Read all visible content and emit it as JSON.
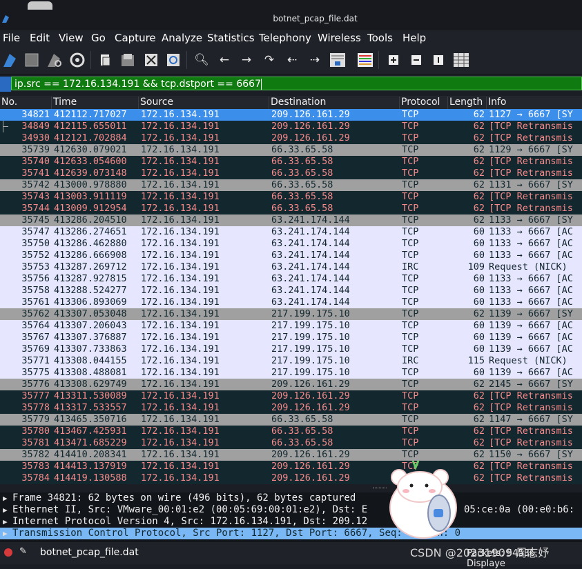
{
  "window": {
    "title": "botnet_pcap_file.dat"
  },
  "menu": [
    "File",
    "Edit",
    "View",
    "Go",
    "Capture",
    "Analyze",
    "Statistics",
    "Telephony",
    "Wireless",
    "Tools",
    "Help"
  ],
  "filter": {
    "value": "ip.src == 172.16.134.191 && tcp.dstport == 6667",
    "bg": "#0f7a0f"
  },
  "columns": {
    "no": "No.",
    "time": "Time",
    "source": "Source",
    "destination": "Destination",
    "protocol": "Protocol",
    "length": "Length",
    "info": "Info"
  },
  "packets": [
    {
      "no": "34821",
      "time": "412112.717027",
      "src": "172.16.134.191",
      "dst": "209.126.161.29",
      "proto": "TCP",
      "len": "62",
      "info": "1127 → 6667 [SY",
      "style": "sel"
    },
    {
      "no": "34849",
      "time": "412115.655011",
      "src": "172.16.134.191",
      "dst": "209.126.161.29",
      "proto": "TCP",
      "len": "62",
      "info": "[TCP Retransmis",
      "style": "red"
    },
    {
      "no": "34930",
      "time": "412121.702884",
      "src": "172.16.134.191",
      "dst": "209.126.161.29",
      "proto": "TCP",
      "len": "62",
      "info": "[TCP Retransmis",
      "style": "red"
    },
    {
      "no": "35739",
      "time": "412630.079021",
      "src": "172.16.134.191",
      "dst": "66.33.65.58",
      "proto": "TCP",
      "len": "62",
      "info": "1129 → 6667 [SY",
      "style": "gray"
    },
    {
      "no": "35740",
      "time": "412633.054600",
      "src": "172.16.134.191",
      "dst": "66.33.65.58",
      "proto": "TCP",
      "len": "62",
      "info": "[TCP Retransmis",
      "style": "red"
    },
    {
      "no": "35741",
      "time": "412639.073148",
      "src": "172.16.134.191",
      "dst": "66.33.65.58",
      "proto": "TCP",
      "len": "62",
      "info": "[TCP Retransmis",
      "style": "red"
    },
    {
      "no": "35742",
      "time": "413000.978880",
      "src": "172.16.134.191",
      "dst": "66.33.65.58",
      "proto": "TCP",
      "len": "62",
      "info": "1131 → 6667 [SY",
      "style": "gray"
    },
    {
      "no": "35743",
      "time": "413003.911119",
      "src": "172.16.134.191",
      "dst": "66.33.65.58",
      "proto": "TCP",
      "len": "62",
      "info": "[TCP Retransmis",
      "style": "red"
    },
    {
      "no": "35744",
      "time": "413009.912954",
      "src": "172.16.134.191",
      "dst": "66.33.65.58",
      "proto": "TCP",
      "len": "62",
      "info": "[TCP Retransmis",
      "style": "red"
    },
    {
      "no": "35745",
      "time": "413286.204510",
      "src": "172.16.134.191",
      "dst": "63.241.174.144",
      "proto": "TCP",
      "len": "62",
      "info": "1133 → 6667 [SY",
      "style": "gray"
    },
    {
      "no": "35747",
      "time": "413286.274651",
      "src": "172.16.134.191",
      "dst": "63.241.174.144",
      "proto": "TCP",
      "len": "60",
      "info": "1133 → 6667 [AC",
      "style": "blue"
    },
    {
      "no": "35750",
      "time": "413286.462880",
      "src": "172.16.134.191",
      "dst": "63.241.174.144",
      "proto": "TCP",
      "len": "60",
      "info": "1133 → 6667 [AC",
      "style": "blue"
    },
    {
      "no": "35752",
      "time": "413286.666908",
      "src": "172.16.134.191",
      "dst": "63.241.174.144",
      "proto": "TCP",
      "len": "60",
      "info": "1133 → 6667 [AC",
      "style": "blue"
    },
    {
      "no": "35753",
      "time": "413287.269712",
      "src": "172.16.134.191",
      "dst": "63.241.174.144",
      "proto": "IRC",
      "len": "109",
      "info": "Request (NICK)",
      "style": "blue"
    },
    {
      "no": "35756",
      "time": "413287.927815",
      "src": "172.16.134.191",
      "dst": "63.241.174.144",
      "proto": "TCP",
      "len": "60",
      "info": "1133 → 6667 [AC",
      "style": "blue"
    },
    {
      "no": "35758",
      "time": "413288.524277",
      "src": "172.16.134.191",
      "dst": "63.241.174.144",
      "proto": "TCP",
      "len": "60",
      "info": "1133 → 6667 [AC",
      "style": "blue"
    },
    {
      "no": "35761",
      "time": "413306.893069",
      "src": "172.16.134.191",
      "dst": "63.241.174.144",
      "proto": "TCP",
      "len": "60",
      "info": "1133 → 6667 [AC",
      "style": "blue"
    },
    {
      "no": "35762",
      "time": "413307.053048",
      "src": "172.16.134.191",
      "dst": "217.199.175.10",
      "proto": "TCP",
      "len": "62",
      "info": "1139 → 6667 [SY",
      "style": "gray"
    },
    {
      "no": "35764",
      "time": "413307.206043",
      "src": "172.16.134.191",
      "dst": "217.199.175.10",
      "proto": "TCP",
      "len": "60",
      "info": "1139 → 6667 [AC",
      "style": "blue"
    },
    {
      "no": "35767",
      "time": "413307.376887",
      "src": "172.16.134.191",
      "dst": "217.199.175.10",
      "proto": "TCP",
      "len": "60",
      "info": "1139 → 6667 [AC",
      "style": "blue"
    },
    {
      "no": "35769",
      "time": "413307.733863",
      "src": "172.16.134.191",
      "dst": "217.199.175.10",
      "proto": "TCP",
      "len": "60",
      "info": "1139 → 6667 [AC",
      "style": "blue"
    },
    {
      "no": "35771",
      "time": "413308.044155",
      "src": "172.16.134.191",
      "dst": "217.199.175.10",
      "proto": "IRC",
      "len": "115",
      "info": "Request (NICK)",
      "style": "blue"
    },
    {
      "no": "35775",
      "time": "413308.488081",
      "src": "172.16.134.191",
      "dst": "217.199.175.10",
      "proto": "TCP",
      "len": "60",
      "info": "1139 → 6667 [AC",
      "style": "blue"
    },
    {
      "no": "35776",
      "time": "413308.629749",
      "src": "172.16.134.191",
      "dst": "209.126.161.29",
      "proto": "TCP",
      "len": "62",
      "info": "2145 → 6667 [SY",
      "style": "gray"
    },
    {
      "no": "35777",
      "time": "413311.530089",
      "src": "172.16.134.191",
      "dst": "209.126.161.29",
      "proto": "TCP",
      "len": "62",
      "info": "[TCP Retransmis",
      "style": "red"
    },
    {
      "no": "35778",
      "time": "413317.533557",
      "src": "172.16.134.191",
      "dst": "209.126.161.29",
      "proto": "TCP",
      "len": "62",
      "info": "[TCP Retransmis",
      "style": "red"
    },
    {
      "no": "35779",
      "time": "413465.350716",
      "src": "172.16.134.191",
      "dst": "66.33.65.58",
      "proto": "TCP",
      "len": "62",
      "info": "1147 → 6667 [SY",
      "style": "gray"
    },
    {
      "no": "35780",
      "time": "413467.425931",
      "src": "172.16.134.191",
      "dst": "66.33.65.58",
      "proto": "TCP",
      "len": "62",
      "info": "[TCP Retransmis",
      "style": "red"
    },
    {
      "no": "35781",
      "time": "413471.685229",
      "src": "172.16.134.191",
      "dst": "66.33.65.58",
      "proto": "TCP",
      "len": "62",
      "info": "[TCP Retransmis",
      "style": "red"
    },
    {
      "no": "35782",
      "time": "414410.208341",
      "src": "172.16.134.191",
      "dst": "209.126.161.29",
      "proto": "TCP",
      "len": "62",
      "info": "1150 → 6667 [SY",
      "style": "gray"
    },
    {
      "no": "35783",
      "time": "414413.137919",
      "src": "172.16.134.191",
      "dst": "209.126.161.29",
      "proto": "TCP",
      "len": "62",
      "info": "[TCP Retransmis",
      "style": "red"
    },
    {
      "no": "35784",
      "time": "414419.130588",
      "src": "172.16.134.191",
      "dst": "209.126.161.29",
      "proto": "TCP",
      "len": "62",
      "info": "[TCP Retransmis",
      "style": "red"
    }
  ],
  "details": [
    {
      "text": "Frame 34821: 62 bytes on wire (496 bits), 62 bytes captured",
      "selected": false
    },
    {
      "text": "Ethernet II, Src: VMware_00:01:e2 (00:05:69:00:01:e2), Dst: E",
      "tail": "05:ce:0a (00:e0:b6:",
      "selected": false
    },
    {
      "text": "Internet Protocol Version 4, Src: 172.16.134.191, Dst: 209.12",
      "selected": false
    },
    {
      "text": "Transmission Control Protocol, Src Port: 1127, Dst Port: 6667, Seq: 0, Len: 0",
      "selected": true
    }
  ],
  "status": {
    "file": "botnet_pcap_file.dat",
    "packets": "Packets: 54536 · Displaye"
  },
  "watermark": "CSDN @20231909 周志妤",
  "colors": {
    "selected": "#3b8eea",
    "red_bg": "#12272e",
    "red_fg": "#f78a8a",
    "gray": "#a0a0a0",
    "blue": "#e7e6ff"
  }
}
